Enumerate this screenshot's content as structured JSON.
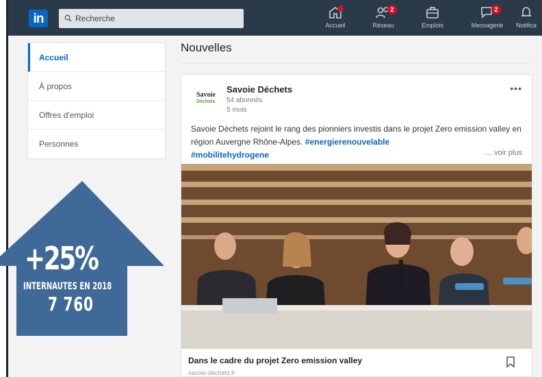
{
  "nav": {
    "logo_text": "in",
    "search_placeholder": "Recherche",
    "items": [
      {
        "label": "Accueil",
        "icon": "home-icon",
        "badge": ""
      },
      {
        "label": "Réseau",
        "icon": "network-icon",
        "badge": "2"
      },
      {
        "label": "Emplois",
        "icon": "briefcase-icon",
        "badge": ""
      },
      {
        "label": "Messagerie",
        "icon": "messaging-icon",
        "badge": "2"
      },
      {
        "label": "Notifica",
        "icon": "bell-icon",
        "badge": ""
      }
    ],
    "colors": {
      "bar": "#2b3a48",
      "accent": "#0a66c2",
      "badge": "#d11124"
    }
  },
  "sidebar": {
    "items": [
      {
        "label": "Accueil",
        "active": true
      },
      {
        "label": "À propos",
        "active": false
      },
      {
        "label": "Offres d'emploi",
        "active": false
      },
      {
        "label": "Personnes",
        "active": false
      }
    ]
  },
  "main": {
    "section_title": "Nouvelles",
    "post": {
      "org_logo_line1": "Savoie",
      "org_logo_line2": "Déchets",
      "org_name": "Savoie Déchets",
      "followers": "54 abonnés",
      "age": "5 mois",
      "more_label": "•••",
      "text": "Savoie Déchets rejoint le rang des pionniers investis dans le projet Zero emission valley en région Auvergne Rhône-Alpes.",
      "hashtag1": "#energierenouvelable",
      "hashtag2": "#mobilitehydrogene",
      "see_more": "… voir plus",
      "link_title": "Dans le cadre du projet Zero emission valley",
      "link_source": "savoie-dechets.fr"
    }
  },
  "overlay": {
    "percent": "+25%",
    "subtitle": "INTERNAUTES EN 2018",
    "count": "7 760",
    "color": "#3f6a98"
  }
}
